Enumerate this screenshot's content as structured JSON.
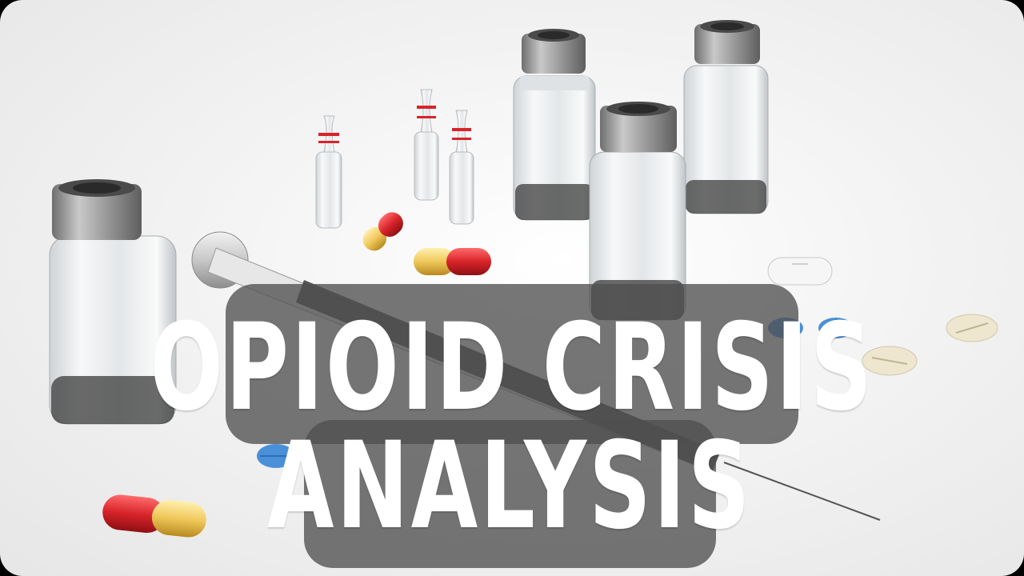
{
  "title": {
    "line1": "OPIOID CRISIS",
    "line2": "ANALYSIS"
  },
  "colors": {
    "overlay": "#505050",
    "title_text": "#ffffff",
    "capsule_red": "#d8242a",
    "capsule_yellow": "#f0c85a",
    "pill_blue": "#4a90d9",
    "pill_cream": "#eee6cf"
  }
}
